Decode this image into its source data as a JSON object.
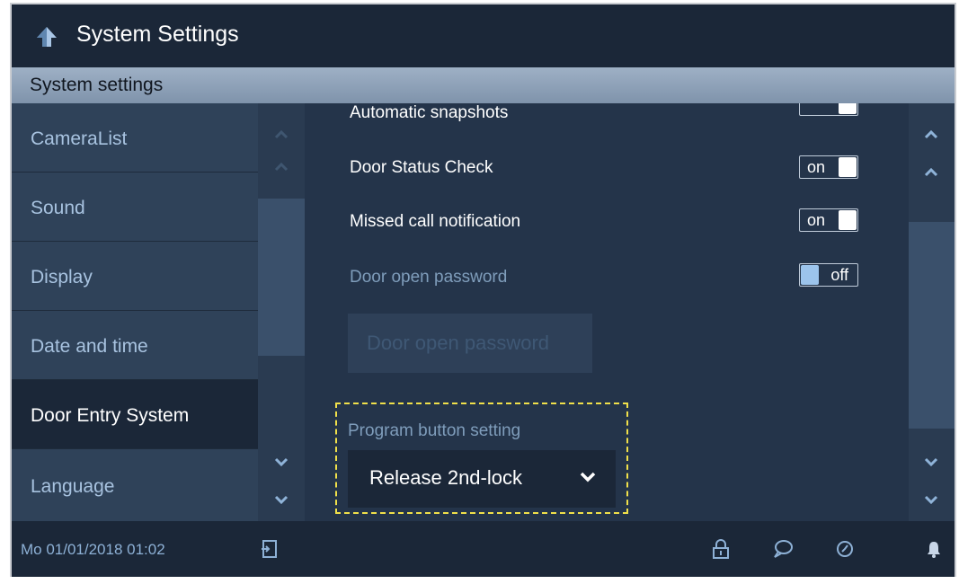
{
  "header": {
    "title": "System Settings"
  },
  "section": {
    "title": "System settings"
  },
  "nav": {
    "items": [
      {
        "label": "CameraList"
      },
      {
        "label": "Sound"
      },
      {
        "label": "Display"
      },
      {
        "label": "Date and time"
      },
      {
        "label": "Door Entry System",
        "active": true
      },
      {
        "label": "Language"
      }
    ]
  },
  "content": {
    "partial_row_label": "Automatic snapshots",
    "rows": [
      {
        "label": "Door Status Check",
        "state": "on"
      },
      {
        "label": "Missed call notification",
        "state": "on"
      },
      {
        "label": "Door open password",
        "state": "off"
      }
    ],
    "door_password_button": "Door open password",
    "program_label": "Program button setting",
    "program_value": "Release 2nd-lock"
  },
  "status": {
    "datetime": "Mo 01/01/2018   01:02",
    "icons": [
      "exit-icon",
      "lock-icon",
      "message-icon",
      "history-icon",
      "bell-icon"
    ]
  },
  "colors": {
    "background": "#24344a",
    "bar": "#1b2738",
    "accent": "#9cc4ec",
    "highlight": "#f0e04a"
  }
}
